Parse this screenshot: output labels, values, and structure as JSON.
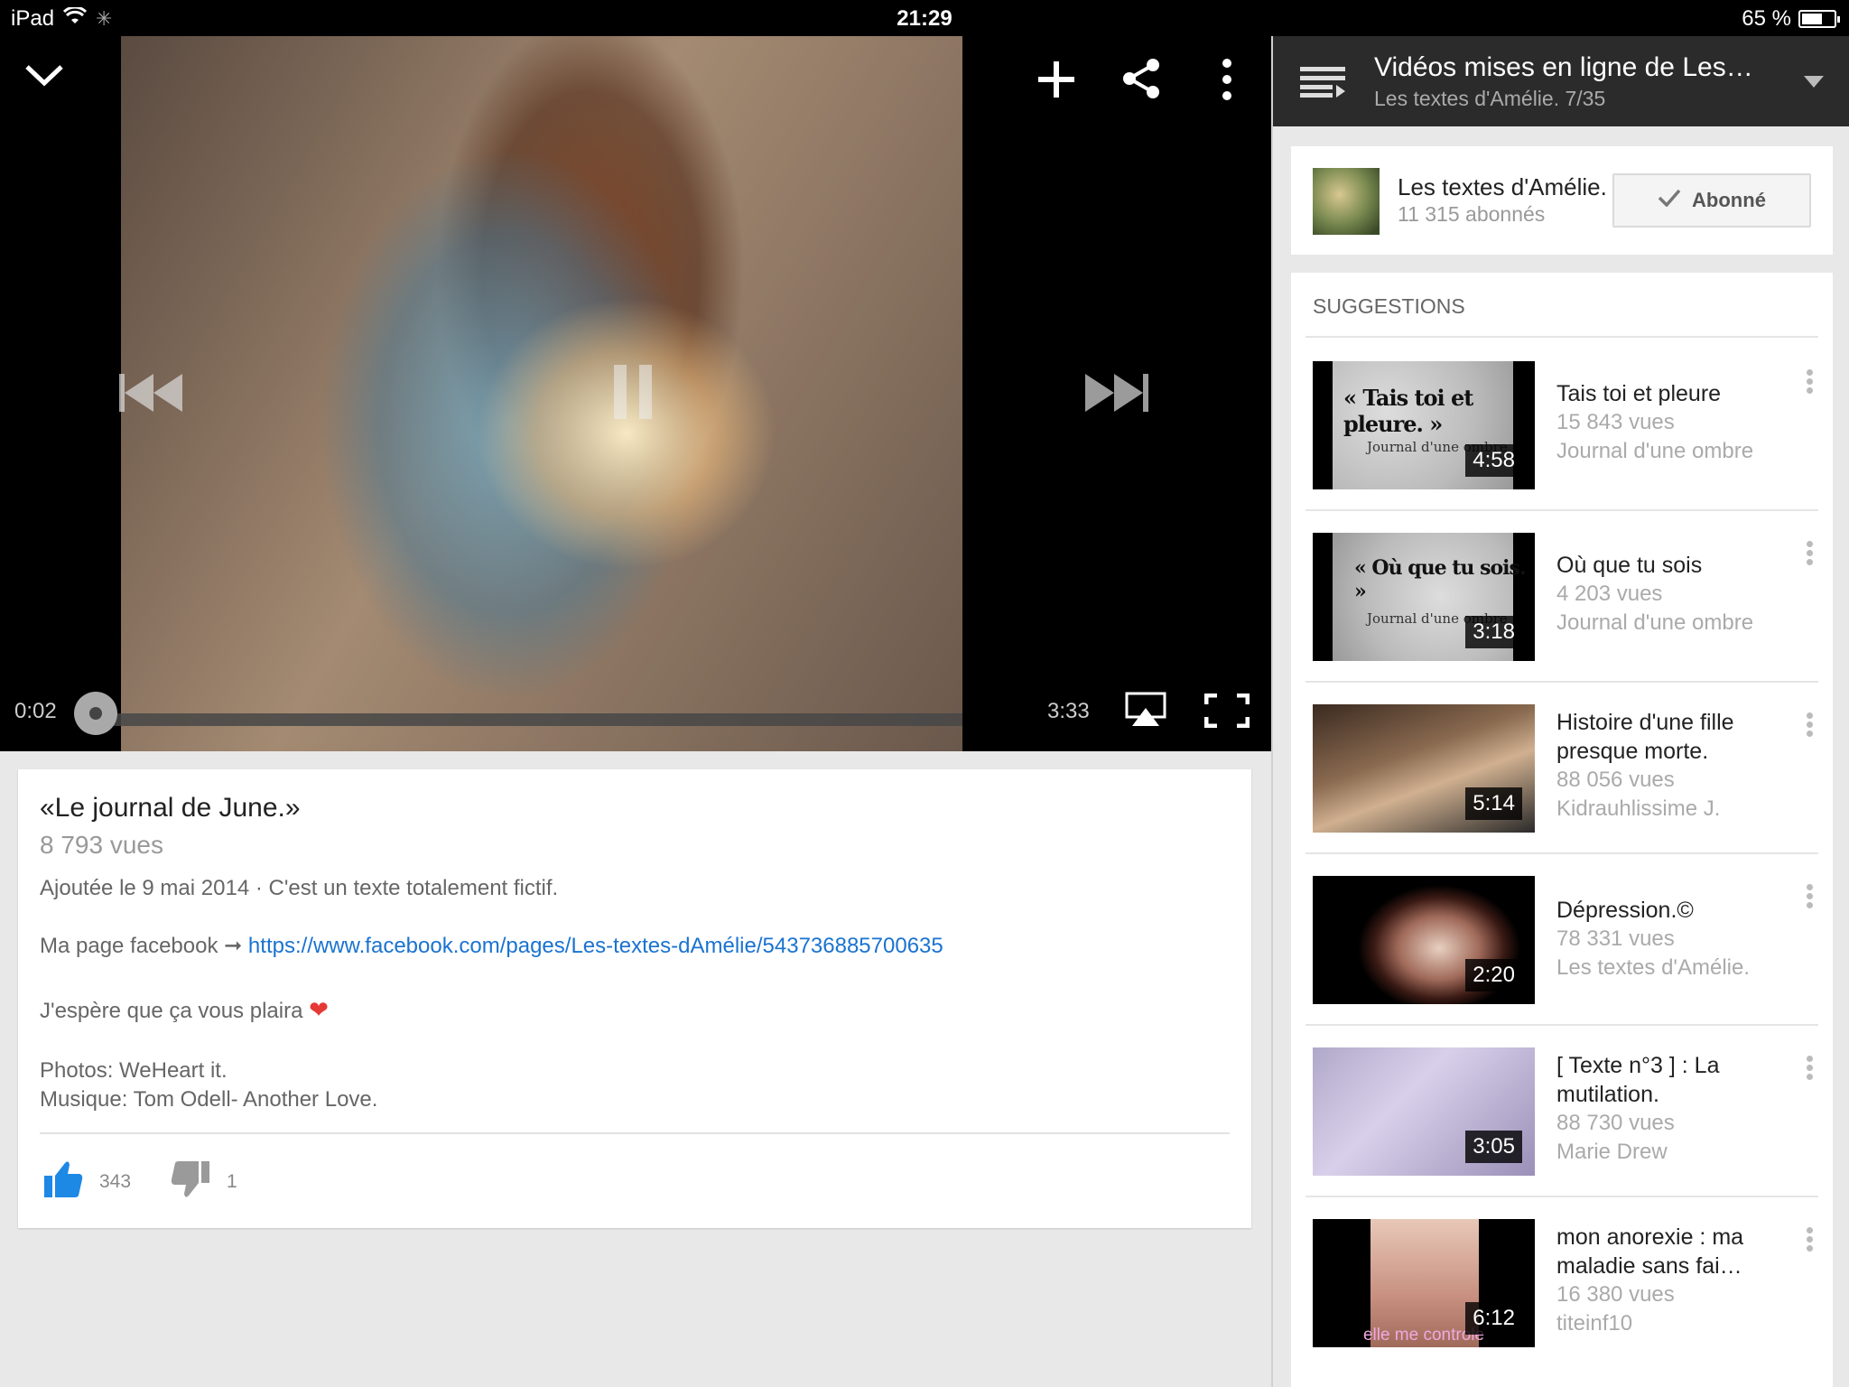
{
  "status_bar": {
    "device": "iPad",
    "time": "21:29",
    "battery": "65 %",
    "battery_level": 0.65
  },
  "player": {
    "current_time": "0:02",
    "duration": "3:33",
    "progress_fraction": 0.01,
    "icons": [
      "chevron-down-icon",
      "add-icon",
      "share-icon",
      "more-vert-icon",
      "skip-previous-icon",
      "pause-icon",
      "skip-next-icon",
      "airplay-icon",
      "fullscreen-icon"
    ]
  },
  "video": {
    "title": "«Le journal de June.»",
    "views": "8 793 vues",
    "desc_added": "Ajoutée le 9 mai 2014 · C'est un texte totalement fictif.",
    "fb_prefix": "Ma page facebook ➞ ",
    "fb_link": "https://www.facebook.com/pages/Les-textes-dAmélie/543736885700635",
    "hope": "J'espère que ça vous plaira",
    "photos": "Photos: WeHeart it.",
    "music": "Musique: Tom Odell- Another Love.",
    "likes": "343",
    "dislikes": "1"
  },
  "playlist_header": {
    "title": "Vidéos mises en ligne de Les…",
    "subtitle": "Les textes d'Amélie.  7/35"
  },
  "channel": {
    "name": "Les textes d'Amélie.",
    "subscribers": "11 315 abonnés",
    "subscribed_label": "Abonné"
  },
  "suggestions": {
    "header": "SUGGESTIONS",
    "items": [
      {
        "title": "Tais toi et pleure",
        "views": "15 843 vues",
        "channel": "Journal d'une ombre",
        "duration": "4:58",
        "thumb_text": "« Tais toi et pleure. »",
        "thumb_sub": "Journal d'une ombre"
      },
      {
        "title": "Où que tu sois",
        "views": "4 203 vues",
        "channel": "Journal d'une ombre",
        "duration": "3:18",
        "thumb_text": "« Où que tu sois. »",
        "thumb_sub": "Journal d'une ombre"
      },
      {
        "title": "Histoire d'une fille presque morte.",
        "views": "88 056 vues",
        "channel": "Kidrauhlissime J.",
        "duration": "5:14"
      },
      {
        "title": "Dépression.©",
        "views": "78 331 vues",
        "channel": "Les textes d'Amélie.",
        "duration": "2:20"
      },
      {
        "title": "[ Texte n°3 ] : La mutilation.",
        "views": "88 730 vues",
        "channel": "Marie Drew",
        "duration": "3:05"
      },
      {
        "title": "mon anorexie : ma maladie sans fai…",
        "views": "16 380 vues",
        "channel": "titeinf10",
        "duration": "6:12",
        "thumb_text": "elle me controle"
      }
    ]
  },
  "colors": {
    "link": "#1a73d0",
    "like_blue": "#1e88e5",
    "header_bg": "#2b2b2b"
  }
}
